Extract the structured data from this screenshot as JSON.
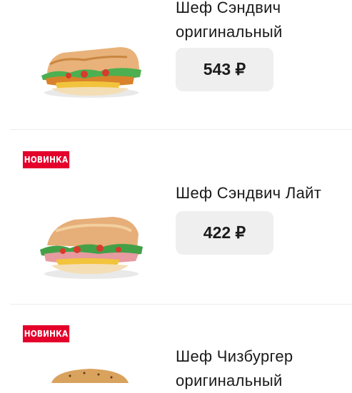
{
  "menu": {
    "items": [
      {
        "badge": "",
        "title_lines": [
          "Шеф Сэндвич",
          "оригинальный"
        ],
        "price": "543 ₽",
        "image": "chicken-sandwich-image"
      },
      {
        "badge": "НОВИНКА",
        "title_lines": [
          "Шеф Сэндвич Лайт"
        ],
        "price": "422 ₽",
        "image": "light-sandwich-image"
      },
      {
        "badge": "НОВИНКА",
        "title_lines": [
          "Шеф Чизбургер",
          "оригинальный"
        ],
        "price": "",
        "image": "cheeseburger-image"
      }
    ]
  },
  "colors": {
    "badge": "#e4002b",
    "price_bg": "#efefef",
    "text": "#111111",
    "divider": "#ececec"
  }
}
